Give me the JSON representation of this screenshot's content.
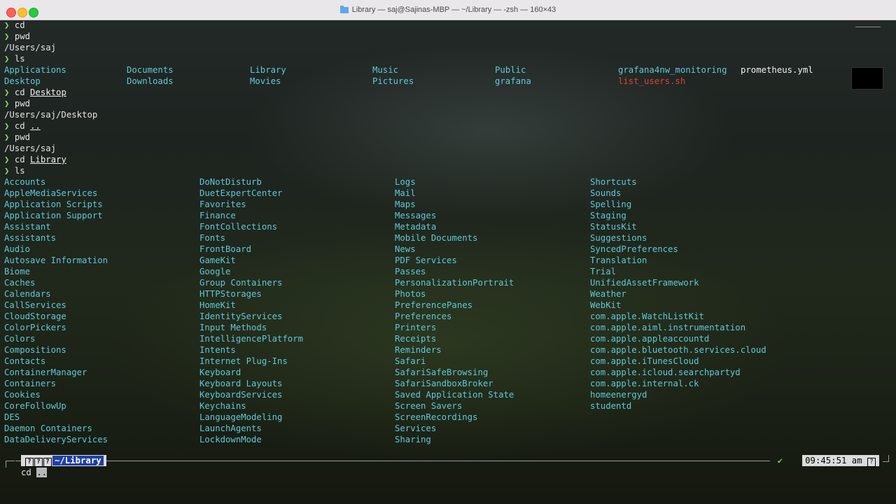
{
  "window": {
    "title": "Library — saj@Sajinas-MBP — ~/Library — -zsh — 160×43",
    "title_icon": "folder-icon"
  },
  "prompt_char": "❯",
  "session": [
    {
      "type": "cmd",
      "cmd": "cd",
      "arg": ""
    },
    {
      "type": "cmd",
      "cmd": "pwd",
      "arg": ""
    },
    {
      "type": "out",
      "text": "/Users/saj"
    },
    {
      "type": "cmd",
      "cmd": "ls",
      "arg": ""
    }
  ],
  "home_ls": {
    "col1": [
      "Applications",
      "Desktop"
    ],
    "col2": [
      "Documents",
      "Downloads"
    ],
    "col3": [
      "Library",
      "Movies"
    ],
    "col4": [
      "Music",
      "Pictures"
    ],
    "col5": [
      "Public",
      "grafana"
    ],
    "col6a": [
      "grafana4nw_monitoring"
    ],
    "col6b": [
      "list_users.sh"
    ],
    "col7": [
      "prometheus.yml"
    ]
  },
  "session2": [
    {
      "cmd": "cd",
      "arg": "Desktop"
    },
    {
      "cmd": "pwd",
      "arg": ""
    },
    {
      "out": "/Users/saj/Desktop"
    },
    {
      "cmd": "cd",
      "arg": ".."
    },
    {
      "cmd": "pwd",
      "arg": ""
    },
    {
      "out": "/Users/saj"
    },
    {
      "cmd": "cd",
      "arg": "Library"
    },
    {
      "cmd": "ls",
      "arg": ""
    }
  ],
  "library_ls": {
    "col1": [
      "Accounts",
      "AppleMediaServices",
      "Application Scripts",
      "Application Support",
      "Assistant",
      "Assistants",
      "Audio",
      "Autosave Information",
      "Biome",
      "Caches",
      "Calendars",
      "CallServices",
      "CloudStorage",
      "ColorPickers",
      "Colors",
      "Compositions",
      "Contacts",
      "ContainerManager",
      "Containers",
      "Cookies",
      "CoreFollowUp",
      "DES",
      "Daemon Containers",
      "DataDeliveryServices"
    ],
    "col2": [
      "DoNotDisturb",
      "DuetExpertCenter",
      "Favorites",
      "Finance",
      "FontCollections",
      "Fonts",
      "FrontBoard",
      "GameKit",
      "Google",
      "Group Containers",
      "HTTPStorages",
      "HomeKit",
      "IdentityServices",
      "Input Methods",
      "IntelligencePlatform",
      "Intents",
      "Internet Plug-Ins",
      "Keyboard",
      "Keyboard Layouts",
      "KeyboardServices",
      "Keychains",
      "LanguageModeling",
      "LaunchAgents",
      "LockdownMode"
    ],
    "col3": [
      "Logs",
      "Mail",
      "Maps",
      "Messages",
      "Metadata",
      "Mobile Documents",
      "News",
      "PDF Services",
      "Passes",
      "PersonalizationPortrait",
      "Photos",
      "PreferencePanes",
      "Preferences",
      "Printers",
      "Receipts",
      "Reminders",
      "Safari",
      "SafariSafeBrowsing",
      "SafariSandboxBroker",
      "Saved Application State",
      "Screen Savers",
      "ScreenRecordings",
      "Services",
      "Sharing"
    ],
    "col4": [
      "Shortcuts",
      "Sounds",
      "Spelling",
      "Staging",
      "StatusKit",
      "Suggestions",
      "SyncedPreferences",
      "Translation",
      "Trial",
      "UnifiedAssetFramework",
      "Weather",
      "WebKit",
      "com.apple.WatchListKit",
      "com.apple.aiml.instrumentation",
      "com.apple.appleaccountd",
      "com.apple.bluetooth.services.cloud",
      "com.apple.iTunesCloud",
      "com.apple.icloud.searchpartyd",
      "com.apple.internal.ck",
      "homeenergyd",
      "studentd"
    ]
  },
  "status": {
    "path": "~/Library",
    "check": "✔",
    "time": "09:45:51 am"
  },
  "input": {
    "cmd": "cd",
    "arg": ".."
  },
  "colors": {
    "dir": "#5fc8d8",
    "exe": "#e0403a",
    "prompt": "#8fd86e",
    "path_bg": "#1f3fa6"
  }
}
